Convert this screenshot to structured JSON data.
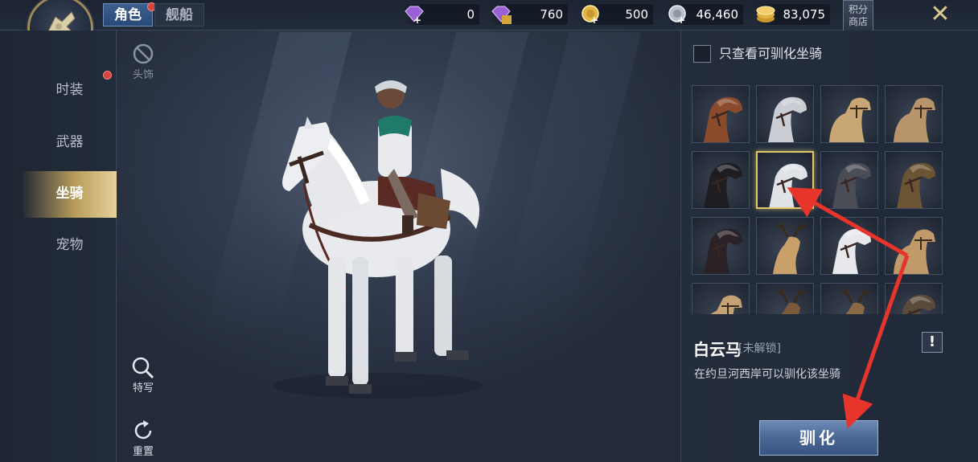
{
  "topbar": {
    "tabs": [
      {
        "label": "角色",
        "active": true,
        "badge": true
      },
      {
        "label": "舰船",
        "active": false,
        "badge": false
      }
    ],
    "currencies": [
      {
        "icon": "purple-diamond-icon",
        "value": "0",
        "plus": true
      },
      {
        "icon": "bound-diamond-icon",
        "value": "760",
        "plus": false,
        "tag": "绑"
      },
      {
        "icon": "gold-coin-icon",
        "value": "500",
        "plus": true
      },
      {
        "icon": "silver-coin-icon",
        "value": "46,460",
        "plus": true
      },
      {
        "icon": "gold-stack-icon",
        "value": "83,075",
        "plus": false
      }
    ],
    "shop_label_1": "积分",
    "shop_label_2": "商店",
    "close_icon": "✕"
  },
  "sidebar": {
    "items": [
      {
        "label": "时装",
        "badge": true
      },
      {
        "label": "武器",
        "badge": false
      },
      {
        "label": "坐骑",
        "badge": false,
        "active": true
      },
      {
        "label": "宠物",
        "badge": false
      }
    ]
  },
  "viewer": {
    "headwear_label": "头饰",
    "closeup_label": "特写",
    "reset_label": "重置"
  },
  "mounts": {
    "filter_label": "只查看可驯化坐骑",
    "filter_checked": false,
    "grid": [
      {
        "kind": "horse",
        "color": "#8a4a2c"
      },
      {
        "kind": "horse",
        "color": "#c9cdd3"
      },
      {
        "kind": "camel",
        "color": "#c8a774"
      },
      {
        "kind": "camel",
        "color": "#b8946a"
      },
      {
        "kind": "horse",
        "color": "#1e1e22"
      },
      {
        "kind": "horse",
        "color": "#dfe2e7",
        "selected": true
      },
      {
        "kind": "horse",
        "color": "#4a4d55"
      },
      {
        "kind": "horse",
        "color": "#6b5433"
      },
      {
        "kind": "horse",
        "color": "#2a2226"
      },
      {
        "kind": "deer",
        "color": "#c9a06a"
      },
      {
        "kind": "horse",
        "color": "#e6e8ec"
      },
      {
        "kind": "camel",
        "color": "#c09a68"
      },
      {
        "kind": "camel",
        "color": "#c4a272"
      },
      {
        "kind": "deer",
        "color": "#7a5a3a"
      },
      {
        "kind": "deer",
        "color": "#8a6a44"
      },
      {
        "kind": "horse",
        "color": "#5a4a3a"
      }
    ],
    "selected_name": "白云马",
    "selected_status": "[未解锁]",
    "info_label": "!",
    "description": "在约旦河西岸可以驯化该坐骑",
    "tame_label": "驯化"
  },
  "colors": {
    "accent_gold": "#e0c86c",
    "arrow_red": "#e8352c",
    "button_blue": "#4a6694"
  }
}
